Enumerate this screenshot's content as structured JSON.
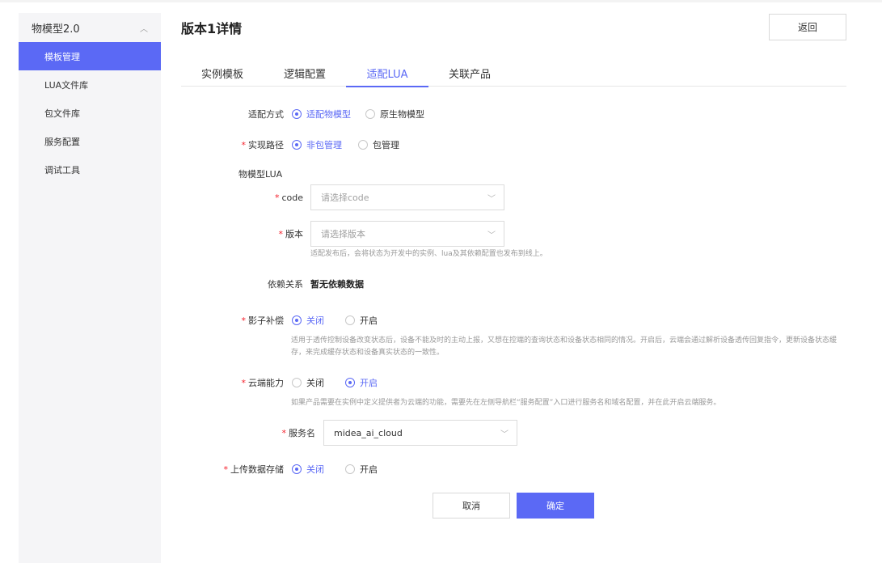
{
  "sidebar": {
    "group_label": "物模型2.0",
    "items": [
      {
        "label": "模板管理",
        "active": true
      },
      {
        "label": "LUA文件库"
      },
      {
        "label": "包文件库"
      },
      {
        "label": "服务配置"
      },
      {
        "label": "调试工具"
      }
    ]
  },
  "header": {
    "title": "版本1详情",
    "back_label": "返回"
  },
  "tabs": [
    {
      "label": "实例模板"
    },
    {
      "label": "逻辑配置"
    },
    {
      "label": "适配LUA",
      "active": true
    },
    {
      "label": "关联产品"
    }
  ],
  "form": {
    "adapt_mode": {
      "label": "适配方式",
      "options": [
        "适配物模型",
        "原生物模型"
      ],
      "selected": 0
    },
    "impl_path": {
      "label": "实现路径",
      "options": [
        "非包管理",
        "包管理"
      ],
      "selected": 0
    },
    "section_label": "物模型LUA",
    "code": {
      "label": "code",
      "placeholder": "请选择code"
    },
    "version": {
      "label": "版本",
      "placeholder": "请选择版本",
      "hint": "适配发布后，会将状态为开发中的实例、lua及其依赖配置也发布到线上。"
    },
    "dependency": {
      "label": "依赖关系",
      "value": "暂无依赖数据"
    },
    "shadow": {
      "label": "影子补偿",
      "options": [
        "关闭",
        "开启"
      ],
      "selected": 0,
      "hint": "适用于透传控制设备改变状态后，设备不能及时的主动上报，又想在控端的查询状态和设备状态相同的情况。开启后，云端会通过解析设备透传回复指令，更新设备状态缓存，来完成缓存状态和设备真实状态的一致性。"
    },
    "cloud": {
      "label": "云端能力",
      "options": [
        "关闭",
        "开启"
      ],
      "selected": 1,
      "hint": "如果产品需要在实例中定义提供者为云端的功能，需要先在左侧导航栏“服务配置”入口进行服务名和域名配置，并在此开启云端服务。"
    },
    "service": {
      "label": "服务名",
      "value": "midea_ai_cloud"
    },
    "upload": {
      "label": "上传数据存储",
      "options": [
        "关闭",
        "开启"
      ],
      "selected": 0
    },
    "cancel_label": "取消",
    "confirm_label": "确定"
  },
  "colors": {
    "accent": "#5b69f5",
    "required": "#f5222d"
  }
}
